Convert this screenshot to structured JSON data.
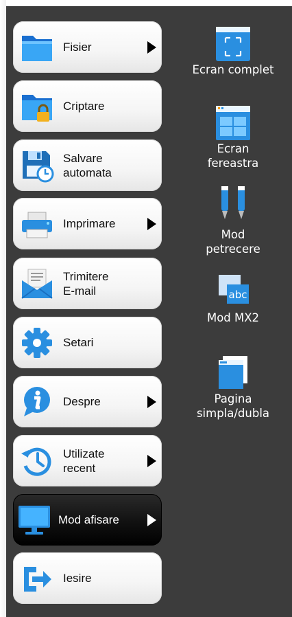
{
  "menu": {
    "items": [
      {
        "id": "fisier",
        "label": "Fisier",
        "has_submenu": true,
        "icon": "folder-icon"
      },
      {
        "id": "criptare",
        "label": "Criptare",
        "has_submenu": false,
        "icon": "locked-folder-icon"
      },
      {
        "id": "salvare",
        "label": "Salvare\nautomata",
        "has_submenu": false,
        "icon": "autosave-icon"
      },
      {
        "id": "imprimare",
        "label": "Imprimare",
        "has_submenu": true,
        "icon": "printer-icon"
      },
      {
        "id": "email",
        "label": "Trimitere\nE-mail",
        "has_submenu": false,
        "icon": "envelope-icon"
      },
      {
        "id": "setari",
        "label": "Setari",
        "has_submenu": false,
        "icon": "gear-icon"
      },
      {
        "id": "despre",
        "label": "Despre",
        "has_submenu": true,
        "icon": "info-icon"
      },
      {
        "id": "recent",
        "label": "Utilizate\nrecent",
        "has_submenu": true,
        "icon": "history-icon"
      },
      {
        "id": "afisare",
        "label": "Mod afisare",
        "has_submenu": true,
        "active": true,
        "icon": "monitor-icon"
      },
      {
        "id": "iesire",
        "label": "Iesire",
        "has_submenu": false,
        "icon": "exit-icon"
      }
    ]
  },
  "display_modes": {
    "options": [
      {
        "id": "fullscreen",
        "label": "Ecran complet",
        "icon": "fullscreen-icon"
      },
      {
        "id": "window",
        "label": "Ecran\nfereastra",
        "icon": "window-icon"
      },
      {
        "id": "party",
        "label": "Mod\npetrecere",
        "icon": "party-mode-icon"
      },
      {
        "id": "mx2",
        "label": "Mod MX2",
        "icon": "abc-icon"
      },
      {
        "id": "page",
        "label": "Pagina\nsimpla/dubla",
        "icon": "pages-icon"
      }
    ]
  },
  "colors": {
    "panel_bg": "#3c3c3c",
    "accent_blue": "#2a8fe0",
    "active_item_bg": "#000000"
  }
}
